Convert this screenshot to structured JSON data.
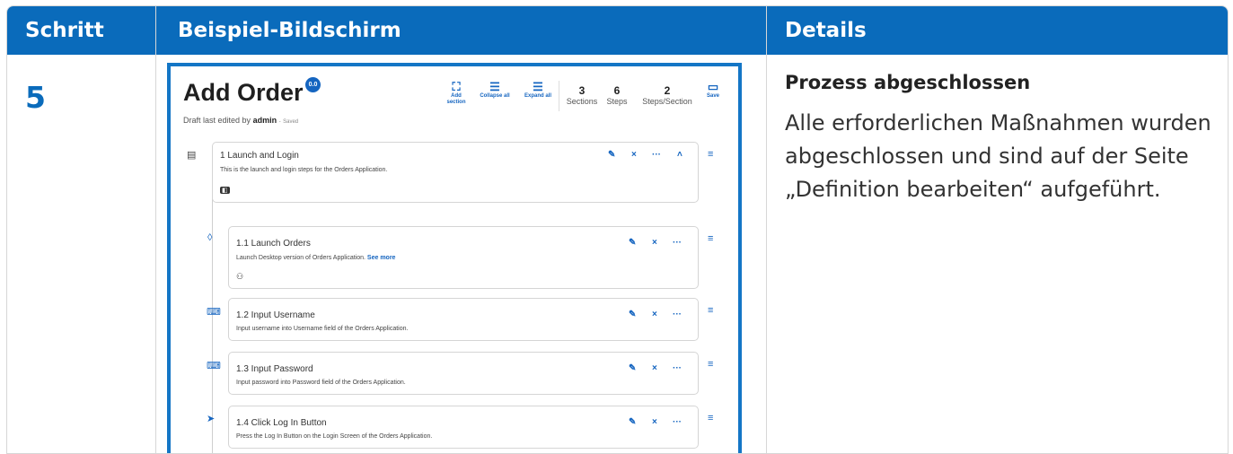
{
  "header": {
    "col1": "Schritt",
    "col2": "Beispiel-Bildschirm",
    "col3": "Details"
  },
  "step": "5",
  "details": {
    "title": "Prozess abgeschlossen",
    "body": "Alle erforderlichen Maßnahmen wurden abgeschlossen und sind auf der Seite „Definition bearbeiten“ aufgeführt."
  },
  "app": {
    "title": "Add Order",
    "version": "0.0",
    "draft_prefix": "Draft last edited by",
    "draft_user": "admin",
    "draft_sep": "-",
    "draft_status": "Saved",
    "toolbar": {
      "add_section": "Add section",
      "collapse_all": "Collapse all",
      "expand_all": "Expand all",
      "save": "Save"
    },
    "stats": [
      {
        "value": "3",
        "label": "Sections"
      },
      {
        "value": "6",
        "label": "Steps"
      },
      {
        "value": "2",
        "label": "Steps/Section"
      }
    ],
    "section": {
      "title": "1 Launch and Login",
      "desc": "This is the launch and login steps for the Orders Application."
    },
    "steps": [
      {
        "title": "1.1 Launch Orders",
        "desc": "Launch Desktop version of Orders Application.",
        "link": "See more"
      },
      {
        "title": "1.2 Input Username",
        "desc": "Input username into Username field of the Orders Application."
      },
      {
        "title": "1.3 Input Password",
        "desc": "Input password into Password field of the Orders Application."
      },
      {
        "title": "1.4 Click Log In Button",
        "desc": "Press the Log In Button on the Login Screen of the Orders Application."
      }
    ],
    "icons": {
      "edit": "✎",
      "delete": "×",
      "more": "···",
      "collapse": "˄",
      "drag": "≡"
    }
  }
}
